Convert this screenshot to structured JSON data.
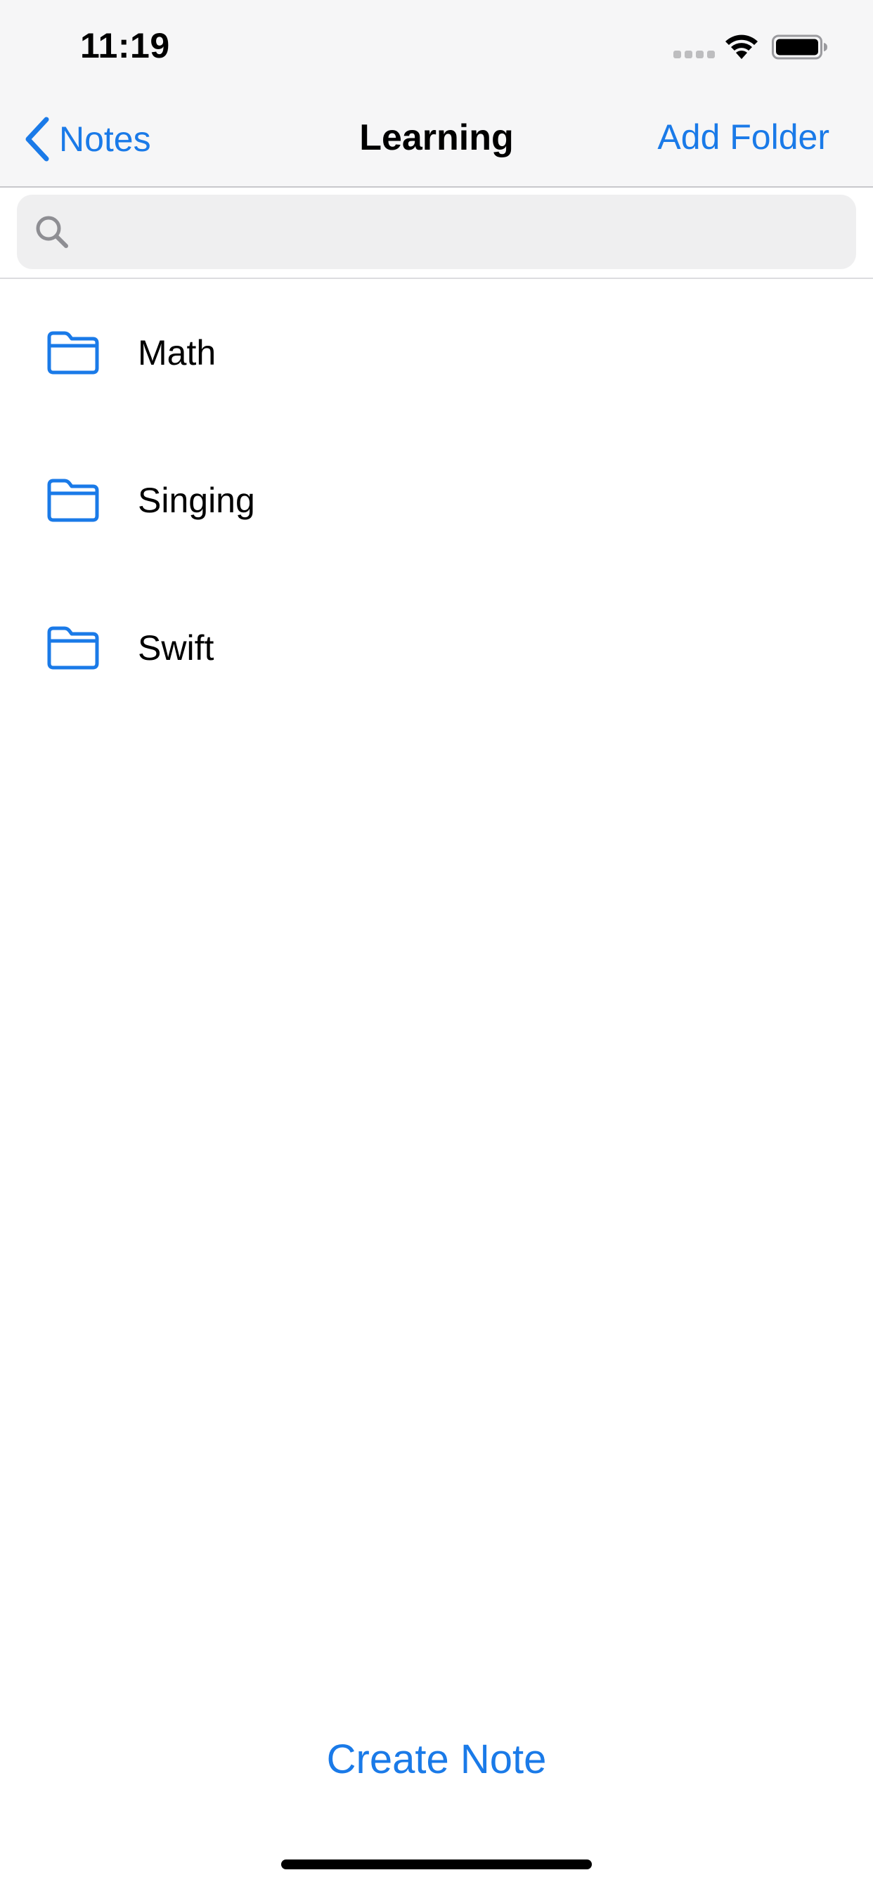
{
  "status_bar": {
    "time": "11:19",
    "signal_icon": "cellular-signal-icon",
    "wifi_icon": "wifi-icon",
    "battery_icon": "battery-icon"
  },
  "nav": {
    "back_label": "Notes",
    "back_icon": "chevron-left-icon",
    "title": "Learning",
    "action_label": "Add Folder"
  },
  "search": {
    "icon": "search-icon",
    "placeholder": "",
    "value": ""
  },
  "folders": [
    {
      "label": "Math",
      "icon": "folder-icon"
    },
    {
      "label": "Singing",
      "icon": "folder-icon"
    },
    {
      "label": "Swift",
      "icon": "folder-icon"
    }
  ],
  "toolbar": {
    "create_note_label": "Create Note"
  },
  "colors": {
    "accent": "#1a7ae8",
    "nav_background": "#f6f6f7",
    "search_background": "#efeff0",
    "text": "#000000"
  }
}
